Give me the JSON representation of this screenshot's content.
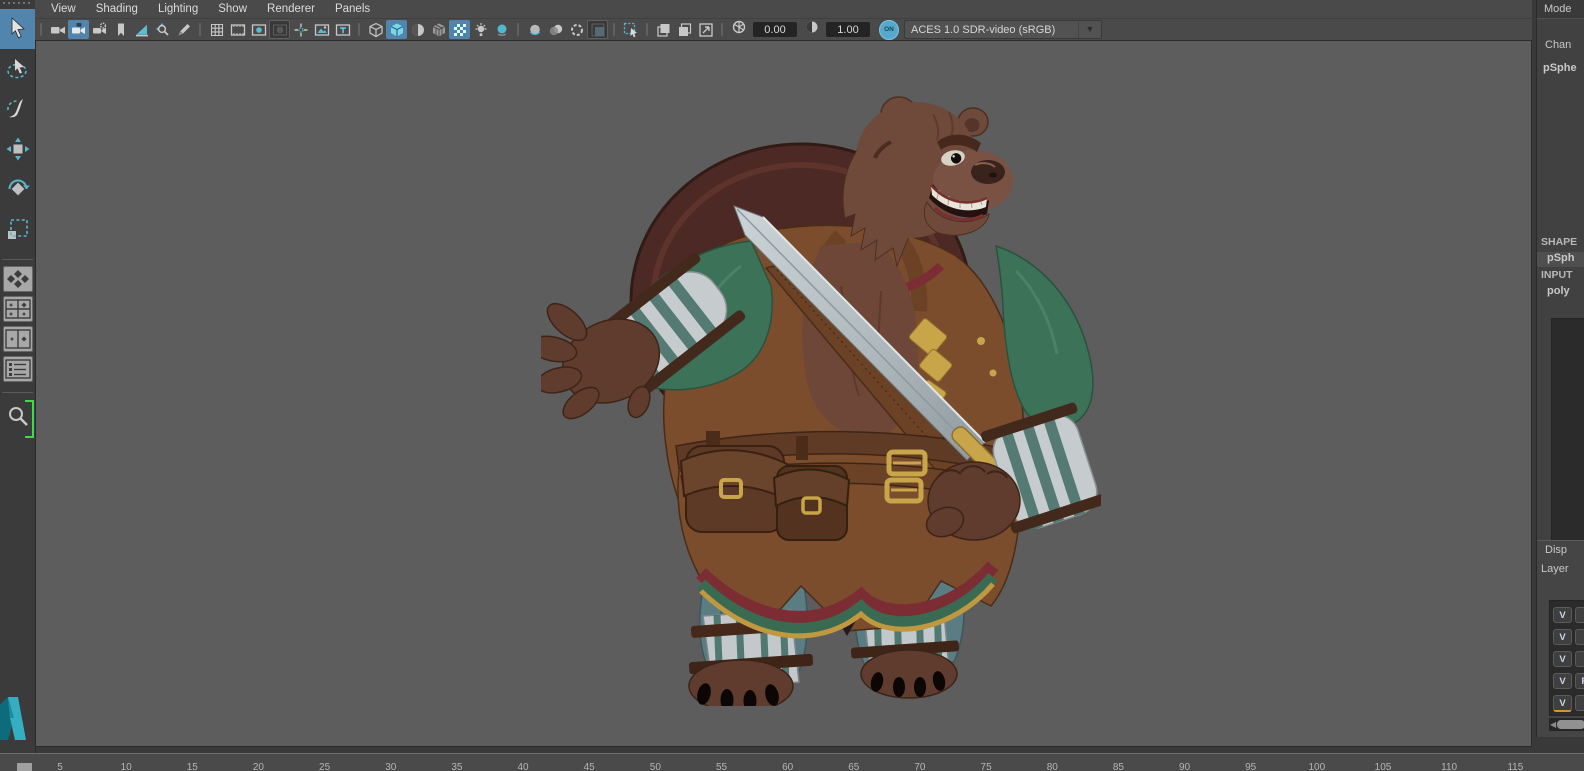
{
  "panel_menu": {
    "items": [
      "View",
      "Shading",
      "Lighting",
      "Show",
      "Renderer",
      "Panels"
    ]
  },
  "toolbar": {
    "icon_groups": [
      [
        {
          "name": "camera"
        },
        {
          "name": "camera-lock",
          "state": "active"
        },
        {
          "name": "camera-gear"
        },
        {
          "name": "bookmark"
        },
        {
          "name": "image-plane"
        },
        {
          "name": "pan-zoom"
        },
        {
          "name": "grease-pencil"
        }
      ],
      [
        {
          "name": "grid"
        },
        {
          "name": "film-gate"
        },
        {
          "name": "resolution-gate"
        },
        {
          "name": "gate-mask",
          "state": "pressed"
        },
        {
          "name": "field-chart"
        },
        {
          "name": "safe-action"
        },
        {
          "name": "safe-title"
        }
      ],
      [
        {
          "name": "wireframe-cube"
        },
        {
          "name": "smooth-shade",
          "state": "active"
        },
        {
          "name": "textured-sphere"
        },
        {
          "name": "wireframe-on-shaded"
        },
        {
          "name": "textured",
          "state": "active"
        },
        {
          "name": "lights"
        },
        {
          "name": "shadows"
        }
      ],
      [
        {
          "name": "occlusion"
        },
        {
          "name": "motion-blur"
        },
        {
          "name": "anti-alias"
        },
        {
          "name": "xray",
          "state": "pressed"
        }
      ],
      [
        {
          "name": "isolate-select"
        }
      ],
      [
        {
          "name": "snapshot-back"
        },
        {
          "name": "snapshot-front"
        },
        {
          "name": "fit-view"
        }
      ]
    ],
    "exposure": {
      "value": "0.00"
    },
    "gamma": {
      "value": "1.00"
    },
    "color_managed_label": "ON",
    "colorspace": "ACES 1.0 SDR-video (sRGB)"
  },
  "toolbox": {
    "tools": [
      "select",
      "lasso",
      "paint-selection",
      "move",
      "rotate",
      "scale"
    ],
    "active_tool": "select",
    "layouts": [
      "single-pane",
      "four-pane",
      "two-pane",
      "outliner-pane"
    ],
    "zoom_tool": "zoom"
  },
  "right_panel": {
    "workspace_label": "Mode",
    "channels_label": "Chan",
    "object_name": "pSphe",
    "shapes_heading": "SHAPE",
    "shape_item": "pSph",
    "inputs_heading": "INPUT",
    "input_item": "poly",
    "display_label": "Disp",
    "layers_label": "Layer",
    "layer_rows": [
      [
        "V"
      ],
      [
        "V"
      ],
      [
        "V"
      ],
      [
        "V",
        "P"
      ],
      [
        "V"
      ]
    ]
  },
  "timeline": {
    "ticks": [
      5,
      10,
      15,
      20,
      25,
      30,
      35,
      40,
      45,
      50,
      55,
      60,
      65,
      70,
      75,
      80,
      85,
      90,
      95,
      100,
      105,
      110,
      115
    ]
  },
  "viewport": {
    "subject": "3D bear warrior character with sword and shield"
  },
  "colors": {
    "active_tool_blue": "#5285ad",
    "icon_teal": "#5bbdd4",
    "viewport_background": "#5d5d5d",
    "ui_background": "#4a4a4a",
    "panel_background": "#414141",
    "zoom_bracket_green": "#3ddb4e",
    "color_managed_toggle_blue": "#57a8cc",
    "bear_fur_brown": "#6f4a3a",
    "bear_shirt_green": "#3c7257",
    "bear_vest_brown": "#7b4d2d",
    "bear_trim_red": "#7c2d33",
    "bear_trim_gold": "#c9a54a",
    "bear_pants_teal": "#5a7c83",
    "bracer_metal_gray": "#c6ccce",
    "sword_blade_gray": "#b9c2c6",
    "shield_maroon": "#4c2924"
  }
}
